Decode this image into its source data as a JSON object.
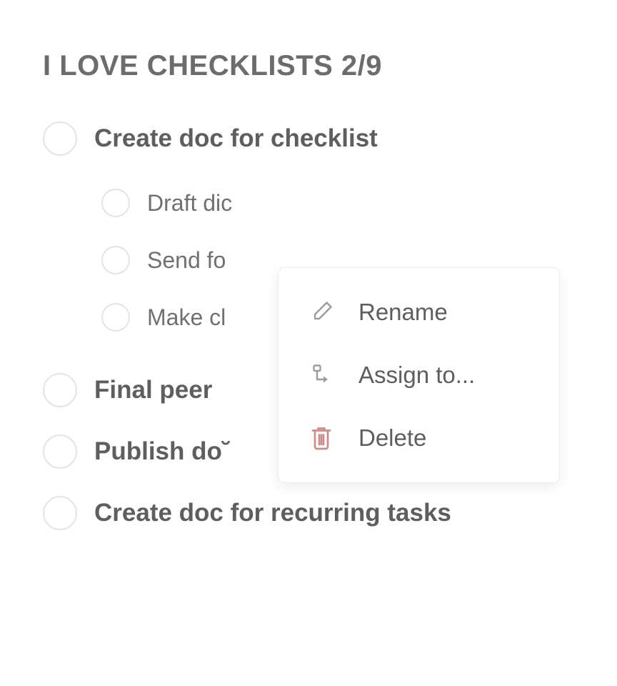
{
  "title": "I LOVE CHECKLISTS 2/9",
  "items": [
    {
      "label": "Create doc for checklist",
      "checked": false
    },
    {
      "label": "Final peer",
      "checked": false
    },
    {
      "label": "Publish do˘",
      "checked": false
    },
    {
      "label": "Create doc for recurring tasks",
      "checked": false
    }
  ],
  "subitems": [
    {
      "label": "Draft dic",
      "checked": false
    },
    {
      "label": "Send fo",
      "checked": false
    },
    {
      "label": "Make cl",
      "checked": false
    }
  ],
  "menu": {
    "rename": "Rename",
    "assign": "Assign to...",
    "delete": "Delete"
  },
  "colors": {
    "text": "#5c5e60",
    "title": "#6a6c6e",
    "border": "#e3e4e5",
    "delete": "#cd8c87"
  }
}
